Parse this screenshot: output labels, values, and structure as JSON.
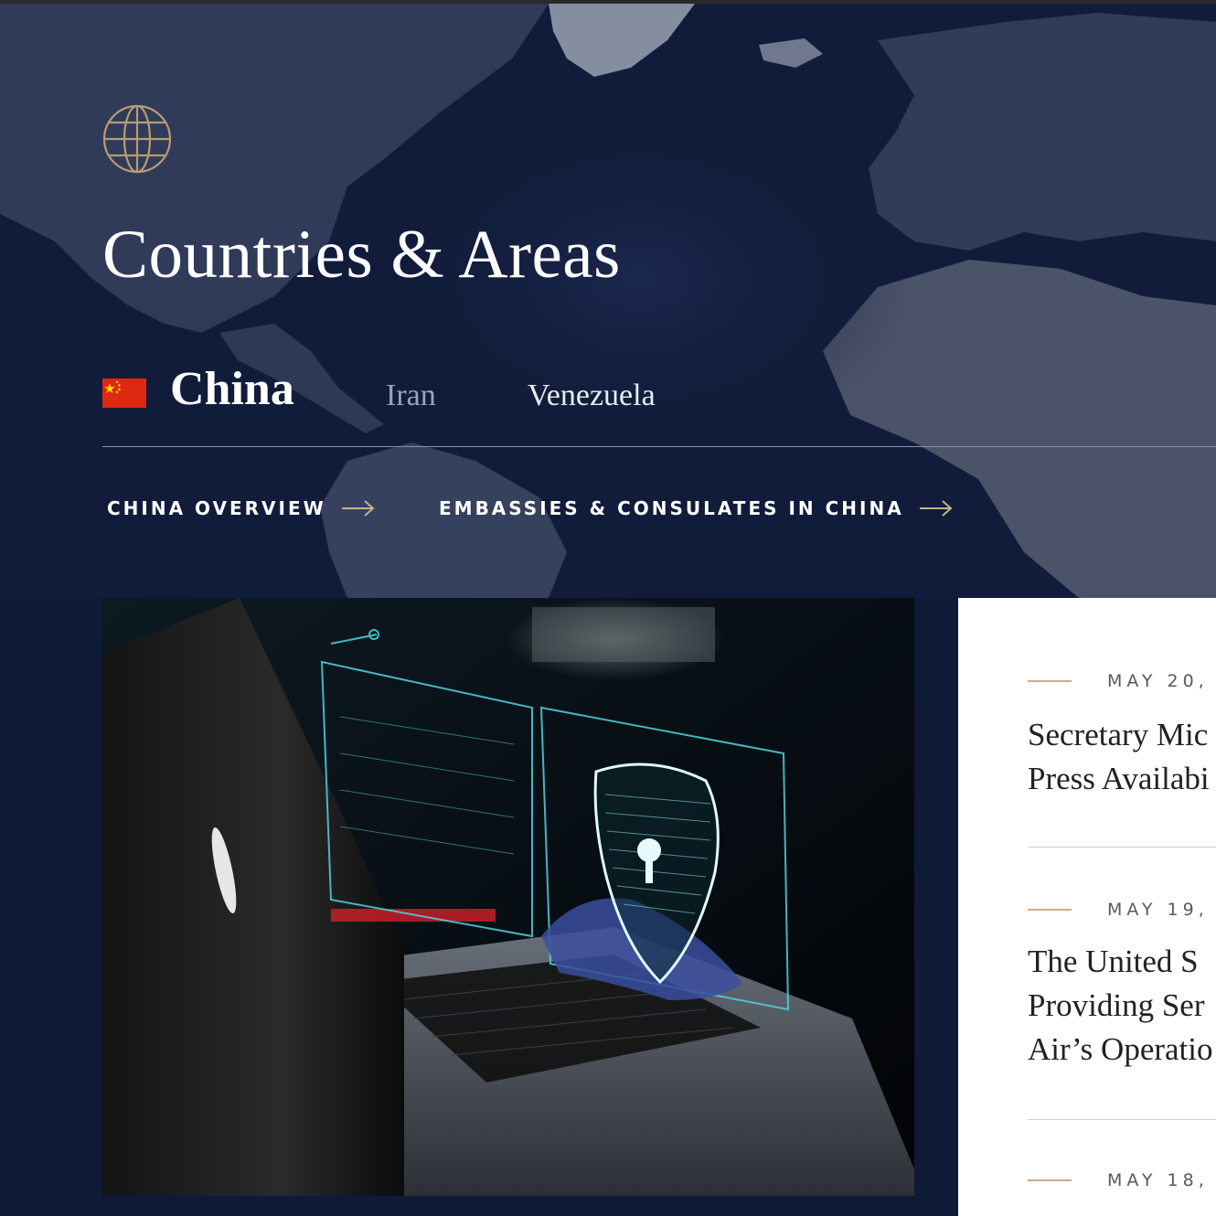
{
  "header": {
    "title": "Countries & Areas"
  },
  "country_tabs": [
    {
      "label": "China",
      "active": true
    },
    {
      "label": "Iran",
      "active": false
    },
    {
      "label": "Venezuela",
      "active": false
    }
  ],
  "sub_links": [
    {
      "label": "CHINA OVERVIEW"
    },
    {
      "label": "EMBASSIES & CONSULATES IN CHINA"
    }
  ],
  "news": [
    {
      "date": "MAY 20,",
      "title_lines": [
        "Secretary Mic",
        "Press Availabi"
      ]
    },
    {
      "date": "MAY 19,",
      "title_lines": [
        "The United S",
        "Providing Ser",
        "Air’s Operatio"
      ]
    },
    {
      "date": "MAY 18,"
    }
  ],
  "colors": {
    "background": "#0f1a36",
    "accent_gold": "#c8b08a",
    "flag_red": "#de2910",
    "flag_yellow": "#ffde00"
  },
  "icons": [
    "globe-icon",
    "china-flag-icon",
    "arrow-right-icon"
  ]
}
